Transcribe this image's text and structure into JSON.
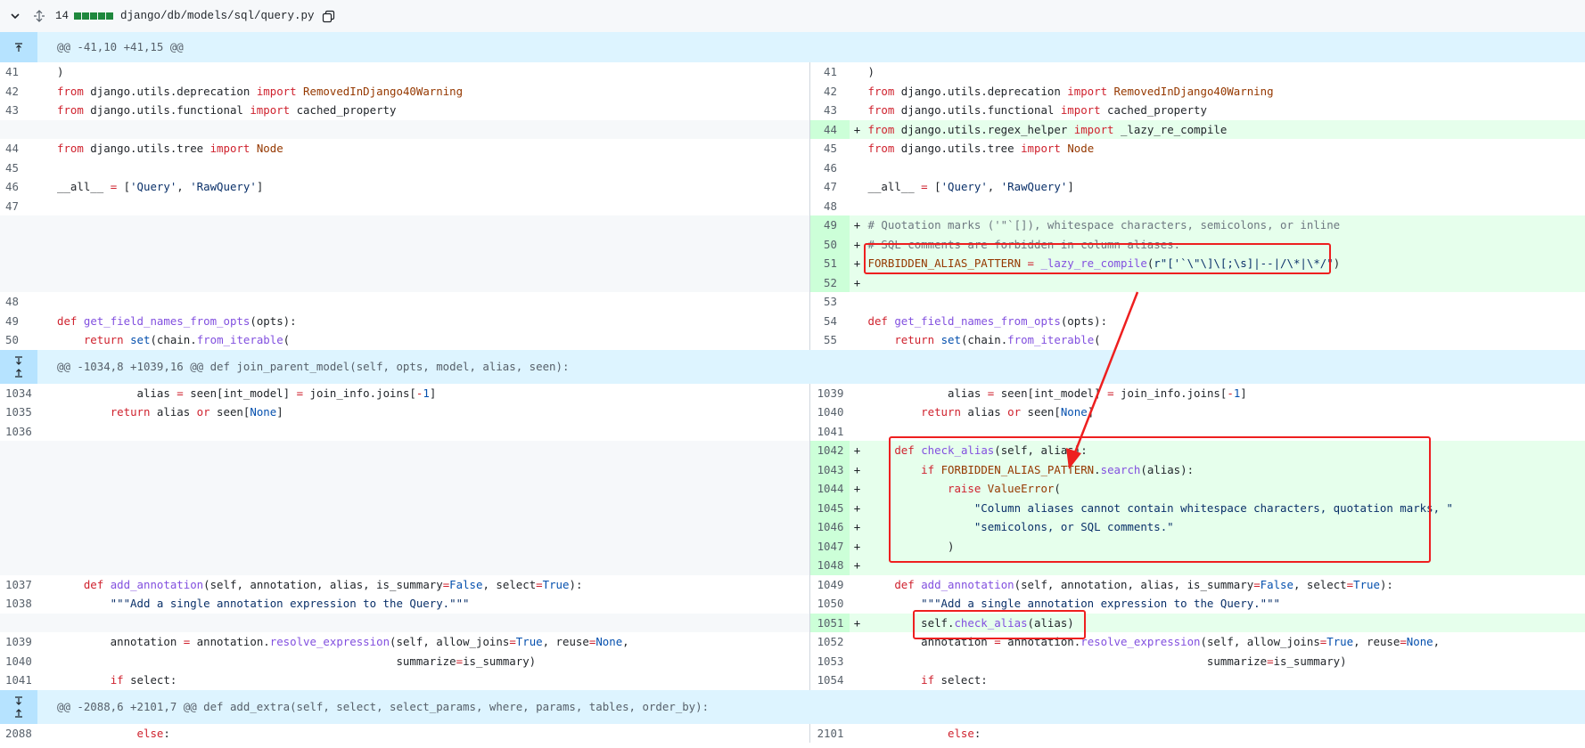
{
  "file": {
    "change_count": "14",
    "path": "django/db/models/sql/query.py",
    "icons": [
      "chevron-down-icon",
      "unfold-icon",
      "copy-icon"
    ]
  },
  "hunks": {
    "h1": "@@ -41,10 +41,15 @@",
    "h2": "@@ -1034,8 +1039,16 @@ def join_parent_model(self, opts, model, alias, seen):",
    "h3": "@@ -2088,6 +2101,7 @@ def add_extra(self, select, select_params, where, params, tables, order_by):"
  },
  "lines": {
    "l41": "41",
    "l42": "42",
    "l43": "43",
    "l44": "44",
    "l45": "45",
    "l46": "46",
    "l47": "47",
    "l48": "48",
    "l49": "49",
    "l50": "50",
    "r41": "41",
    "r42": "42",
    "r43": "43",
    "r44": "44",
    "r45": "45",
    "r46": "46",
    "r47": "47",
    "r48": "48",
    "r49": "49",
    "r50": "50",
    "r51": "51",
    "r52": "52",
    "r53": "53",
    "r54": "54",
    "r55": "55",
    "l1034": "1034",
    "l1035": "1035",
    "l1036": "1036",
    "l1037": "1037",
    "l1038": "1038",
    "l1039": "1039",
    "l1040": "1040",
    "l1041": "1041",
    "r1039": "1039",
    "r1040": "1040",
    "r1041": "1041",
    "r1042": "1042",
    "r1043": "1043",
    "r1044": "1044",
    "r1045": "1045",
    "r1046": "1046",
    "r1047": "1047",
    "r1048": "1048",
    "r1049": "1049",
    "r1050": "1050",
    "r1051": "1051",
    "r1052": "1052",
    "r1053": "1053",
    "r1054": "1054",
    "l2088": "2088",
    "r2101": "2101"
  },
  "markers": {
    "plus": "+"
  },
  "colors": {
    "add_bg": "#e6ffec",
    "add_num_bg": "#ccffd8",
    "hunk_bg": "#ddf4ff",
    "highlight": "#ee1f1f"
  }
}
